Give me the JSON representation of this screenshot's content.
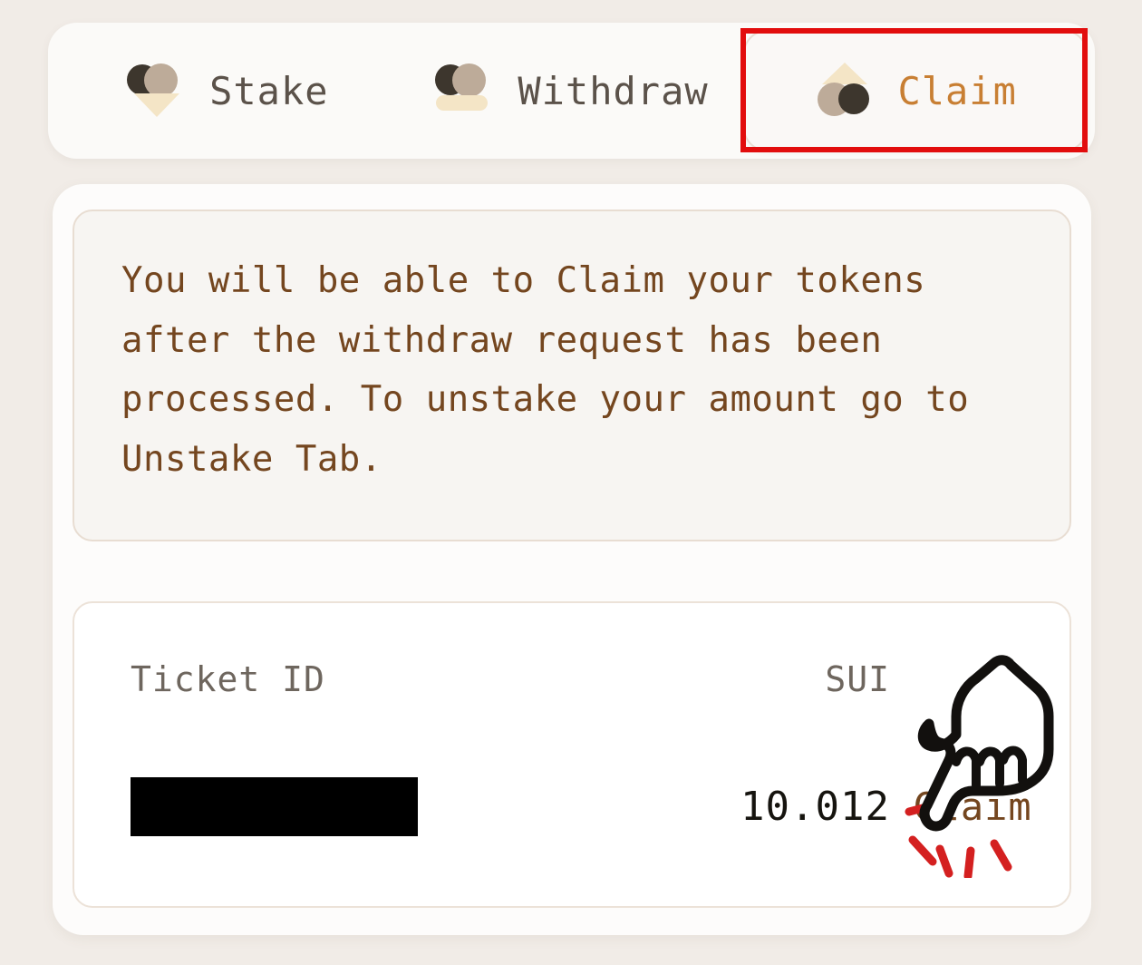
{
  "theme": {
    "page_background": "#f1ece7",
    "card_background": "#fdfcfb",
    "accent_active": "#c87f33",
    "text_brown": "#74461f",
    "text_gray": "#5b524a",
    "border_tan": "#e8ddd2",
    "annotation_red": "#e20d0d",
    "icon_dark": "#3d362d",
    "icon_tan": "#bdab99",
    "icon_cream": "#f4e5c6"
  },
  "tabs": [
    {
      "label": "Stake",
      "icon": "stake-icon",
      "active": false
    },
    {
      "label": "Withdraw",
      "icon": "withdraw-icon",
      "active": false
    },
    {
      "label": "Claim",
      "icon": "claim-icon",
      "active": true
    }
  ],
  "info": {
    "text": "You will be able to Claim your tokens after the withdraw request has been processed. To unstake your amount go to Unstake Tab."
  },
  "ticket_table": {
    "columns": [
      "Ticket ID",
      "SUI",
      ""
    ],
    "headers": {
      "ticket_id": "Ticket ID",
      "sui": "SUI",
      "action": ""
    },
    "rows": [
      {
        "ticket_id": "",
        "ticket_id_redacted": true,
        "amount": "10.012",
        "action_label": "Claim"
      }
    ]
  },
  "annotations": {
    "highlight_target": "Claim",
    "cursor": "pointing-hand-cursor",
    "click_effect": "click-burst"
  }
}
